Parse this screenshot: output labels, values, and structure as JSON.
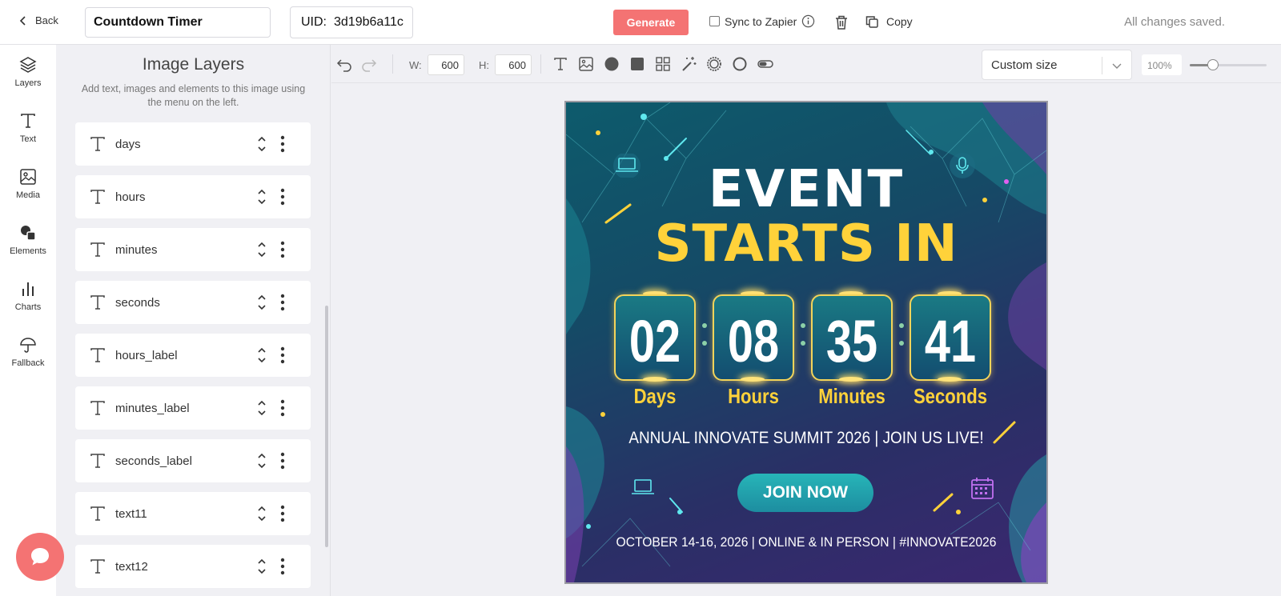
{
  "topbar": {
    "back_label": "Back",
    "template_name": "Countdown Timer",
    "uid_label": "UID:",
    "uid_value": "3d19b6a11c",
    "generate_label": "Generate",
    "sync_label": "Sync to Zapier",
    "copy_label": "Copy",
    "status": "All changes saved."
  },
  "rail": {
    "items": [
      {
        "label": "Layers",
        "icon": "layers-icon"
      },
      {
        "label": "Text",
        "icon": "text-icon"
      },
      {
        "label": "Media",
        "icon": "image-icon"
      },
      {
        "label": "Elements",
        "icon": "shapes-icon"
      },
      {
        "label": "Charts",
        "icon": "bar-chart-icon"
      },
      {
        "label": "Fallback",
        "icon": "umbrella-icon"
      }
    ]
  },
  "panel": {
    "title": "Image Layers",
    "subtitle": "Add text, images and elements to this image using the menu on the left.",
    "layers": [
      "days",
      "hours",
      "minutes",
      "seconds",
      "hours_label",
      "minutes_label",
      "seconds_label",
      "text11",
      "text12"
    ]
  },
  "toolbar": {
    "width_label": "W:",
    "width_value": "600",
    "height_label": "H:",
    "height_value": "600",
    "size_option": "Custom size",
    "zoom_level": "100%",
    "zoom_slider_fraction": 0.3
  },
  "canvas": {
    "title_line1": "EVENT",
    "title_line2": "STARTS IN",
    "countdown": [
      {
        "value": "02",
        "unit": "Days"
      },
      {
        "value": "08",
        "unit": "Hours"
      },
      {
        "value": "35",
        "unit": "Minutes"
      },
      {
        "value": "41",
        "unit": "Seconds"
      }
    ],
    "summit_text": "ANNUAL INNOVATE SUMMIT 2026 | JOIN US LIVE!",
    "cta_label": "JOIN NOW",
    "dates_text": "OCTOBER 14-16, 2026 | ONLINE & IN PERSON | #INNOVATE2026"
  },
  "colors": {
    "accent": "#f47373",
    "title_yellow": "#ffd23a",
    "canvas_teal": "#0d5b6c",
    "canvas_purple": "#3b2770",
    "cta_teal": "#27b5b8"
  }
}
